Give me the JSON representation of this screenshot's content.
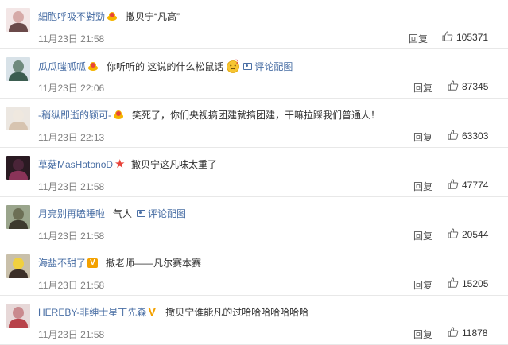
{
  "reply_label": "回复",
  "comments": [
    {
      "username": "細胞呼吸不對勁",
      "badge": "crown",
      "text": "撒贝宁“凡高”",
      "time": "11月23日 21:58",
      "likes": "105371",
      "avatar_colors": [
        "#f3e6e6",
        "#6b4a4a",
        "#d6aaa8"
      ]
    },
    {
      "username": "瓜瓜嗤呱呱",
      "badge": "crown",
      "text": "你听听的 这说的什么松鼠话",
      "emoji": "thinking-emoji",
      "pic_link": "评论配图",
      "time": "11月23日 22:06",
      "likes": "87345",
      "avatar_colors": [
        "#d8e2e8",
        "#3b5d50",
        "#6f8a7d"
      ]
    },
    {
      "username": "-稍纵即逝的颖可-",
      "badge": "crown",
      "text": "笑死了，你们央视搞团建就搞团建，干嘛拉踩我们普通人！",
      "time": "11月23日 22:13",
      "likes": "63303",
      "avatar_colors": [
        "#ece7e1",
        "#d7c4b0",
        "#efe8df"
      ]
    },
    {
      "username": "草菇MasHatonoD",
      "badge": "star",
      "text": "撒贝宁这凡味太重了",
      "time": "11月23日 21:58",
      "likes": "47774",
      "avatar_colors": [
        "#2a1a22",
        "#8a3358",
        "#4a2438"
      ]
    },
    {
      "username": "月亮别再瞌睡啦",
      "badge": "none",
      "text": "气人",
      "pic_link": "评论配图",
      "time": "11月23日 21:58",
      "likes": "20544",
      "avatar_colors": [
        "#9aa58c",
        "#3d3a2e",
        "#6c6f55"
      ]
    },
    {
      "username": "海盐不甜了",
      "badge": "vip",
      "text": "撒老师——凡尔赛本赛",
      "time": "11月23日 21:58",
      "likes": "15205",
      "avatar_colors": [
        "#c9c0aa",
        "#3b2f28",
        "#f0d040"
      ]
    },
    {
      "username": "HEREBY-非绅士星丁先森",
      "badge": "vgold",
      "text": "撒贝宁谁能凡的过哈哈哈哈哈哈哈",
      "time": "11月23日 21:58",
      "likes": "11878",
      "avatar_colors": [
        "#e7d8d8",
        "#b8424a",
        "#c98a8e"
      ]
    }
  ]
}
